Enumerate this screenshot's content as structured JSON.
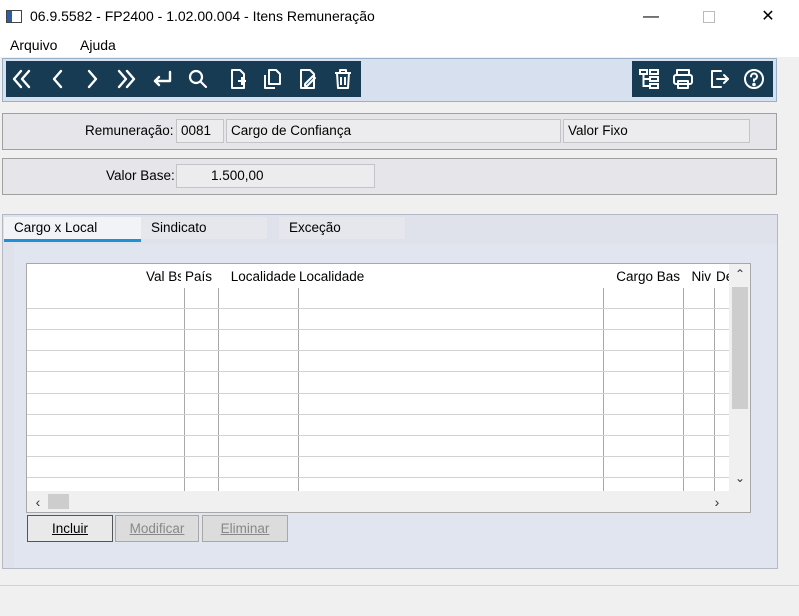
{
  "window": {
    "title": "06.9.5582 - FP2400 - 1.02.00.004 - Itens Remuneração",
    "controls": [
      "minimize-icon",
      "maximize-icon",
      "close-icon"
    ]
  },
  "menu": {
    "items": [
      "Arquivo",
      "Ajuda"
    ]
  },
  "toolbar": {
    "left_icons": [
      "first-record-icon",
      "previous-record-icon",
      "next-record-icon",
      "last-record-icon",
      "return-icon",
      "search-icon",
      "new-document-icon",
      "copy-document-icon",
      "edit-document-icon",
      "delete-icon"
    ],
    "right_icons": [
      "tree-structure-icon",
      "print-icon",
      "exit-icon",
      "help-icon"
    ],
    "background": "#163b52"
  },
  "remuneracao": {
    "label": "Remuneração:",
    "code": "0081",
    "description": "Cargo de Confiança",
    "type": "Valor Fixo"
  },
  "valor_base": {
    "label": "Valor Base:",
    "value": "1.500,00"
  },
  "tabs": [
    {
      "label": "Cargo x Local",
      "active": true
    },
    {
      "label": "Sindicato",
      "active": false
    },
    {
      "label": "Exceção",
      "active": false
    }
  ],
  "grid": {
    "columns": [
      "Val Bs",
      "País",
      "Localidade",
      "Localidade",
      "Cargo Bas",
      "Niv",
      "De"
    ],
    "rows": []
  },
  "buttons": {
    "incluir": "Incluir",
    "modificar": "Modificar",
    "eliminar": "Eliminar"
  },
  "colors": {
    "accent": "#1e90d8",
    "toolbar": "#163b52"
  }
}
